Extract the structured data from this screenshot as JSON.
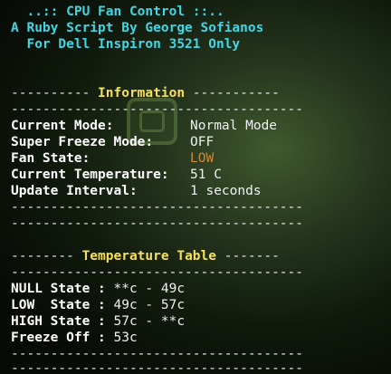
{
  "header": {
    "line1": "  ..:: CPU Fan Control ::..",
    "line2": "A Ruby Script By George Sofianos",
    "line3": "  For Dell Inspiron 3521 Only"
  },
  "separator": "-------------------------------------",
  "info_section": {
    "left": "---------- ",
    "title": "Information",
    "right": " -----------",
    "rows": [
      {
        "label": "Current Mode:",
        "value": "Normal Mode"
      },
      {
        "label": "Super Freeze Mode:",
        "value": "OFF"
      },
      {
        "label": "Fan State:",
        "value": "LOW"
      },
      {
        "label": "Current Temperature:",
        "value": "51 C"
      },
      {
        "label": "Update Interval:",
        "value": "1 seconds"
      }
    ]
  },
  "temp_section": {
    "left": "-------- ",
    "title": "Temperature Table",
    "right": " -------",
    "rows": [
      {
        "label": "NULL State : ",
        "value": "**c - 49c"
      },
      {
        "label": "LOW  State : ",
        "value": "49c - 57c"
      },
      {
        "label": "HIGH State : ",
        "value": "57c - **c"
      },
      {
        "label": "Freeze Off : ",
        "value": "53c"
      }
    ]
  },
  "colors": {
    "title": "#3fd7e6",
    "section": "#f6e05a",
    "fan_state_low": "#d08a3a"
  }
}
